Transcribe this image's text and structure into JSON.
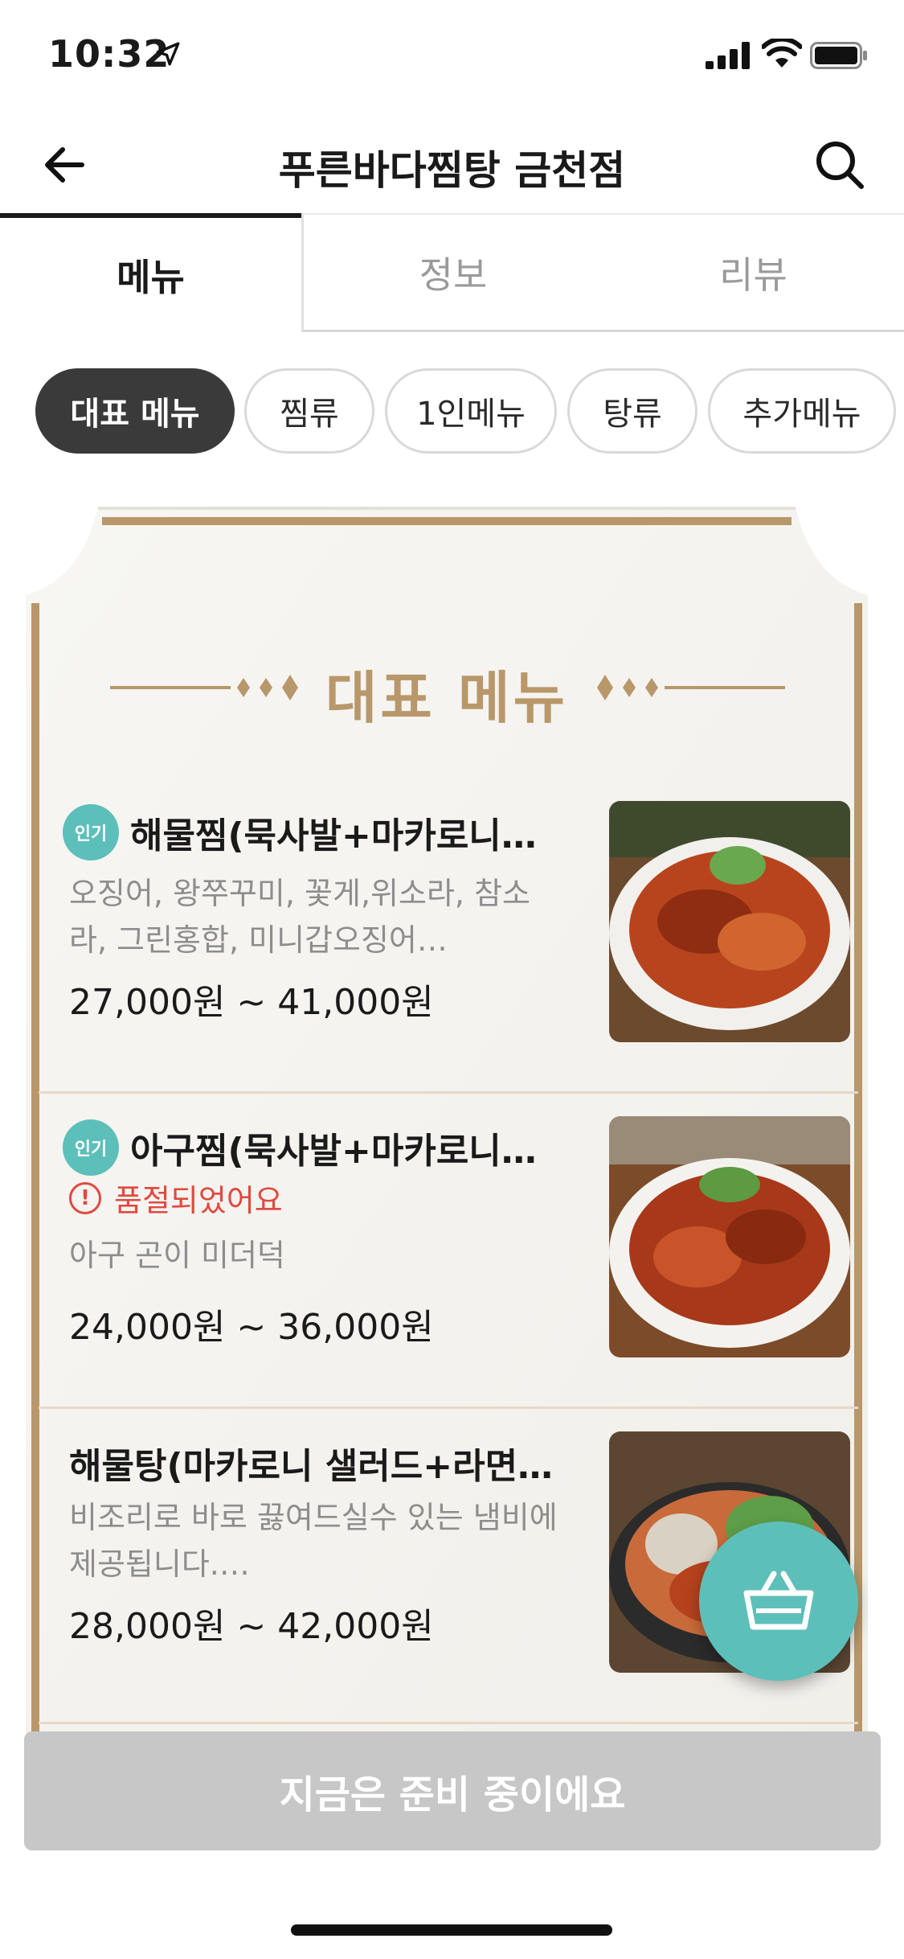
{
  "status_bar": {
    "time": "10:32"
  },
  "header": {
    "title": "푸른바다찜탕 금천점"
  },
  "tabs": [
    {
      "label": "메뉴",
      "selected": true
    },
    {
      "label": "정보",
      "selected": false
    },
    {
      "label": "리뷰",
      "selected": false
    }
  ],
  "chips": [
    {
      "label": "대표 메뉴",
      "selected": true
    },
    {
      "label": "찜류",
      "selected": false
    },
    {
      "label": "1인메뉴",
      "selected": false
    },
    {
      "label": "탕류",
      "selected": false
    },
    {
      "label": "추가메뉴",
      "selected": false
    }
  ],
  "section": {
    "title": "대표 메뉴"
  },
  "items": [
    {
      "badge": "인기",
      "name": "해물찜(묵사발+마카로니…",
      "desc": "오징어, 왕쭈꾸미, 꽃게,위소라, 참소라, 그린홍합, 미니갑오징어…",
      "price": "27,000원 ~ 41,000원"
    },
    {
      "badge": "인기",
      "name": "아구찜(묵사발+마카로니…",
      "soldout": "품절되었어요",
      "desc": "아구 곤이 미더덕",
      "price": "24,000원 ~ 36,000원"
    },
    {
      "name": "해물탕(마카로니 샐러드+라면…",
      "desc": "비조리로 바로 끓여드실수 있는 냄비에 제공됩니다.…",
      "price": "28,000원 ~ 42,000원"
    }
  ],
  "bottom_bar": {
    "label": "지금은 준비 중이에요"
  },
  "colors": {
    "accent": "#5dbfb9",
    "gold": "#b8976a",
    "soldout": "#e0493f",
    "disabled": "#c7c7c7"
  },
  "icons": [
    "location-arrow-icon",
    "signal-icon",
    "wifi-icon",
    "battery-icon",
    "back-arrow-icon",
    "search-icon",
    "alert-circle-icon",
    "basket-icon"
  ]
}
